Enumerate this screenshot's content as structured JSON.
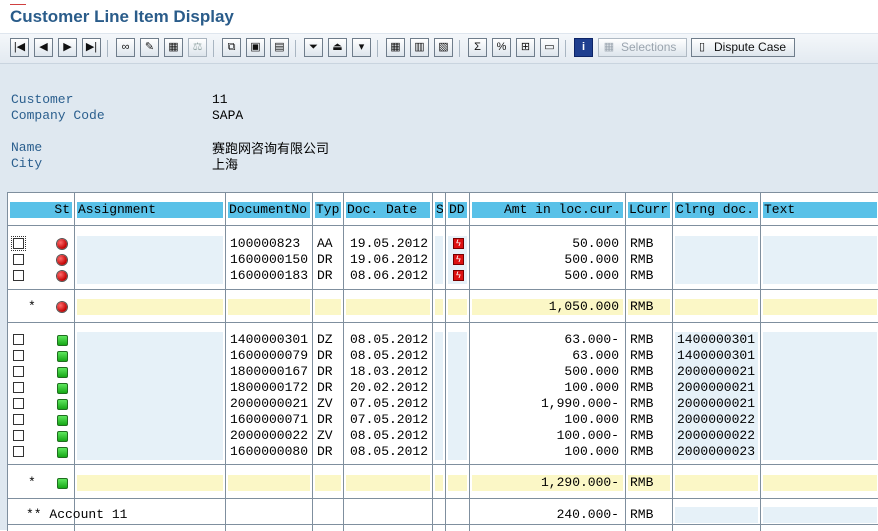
{
  "window": {
    "title": "Customer Line Item Display"
  },
  "toolbar": {
    "selections_label": "Selections",
    "dispute_case_label": "Dispute Case"
  },
  "header_fields": {
    "customer_label": "Customer",
    "customer_value": "11",
    "company_code_label": "Company Code",
    "company_code_value": "SAPA",
    "name_label": "Name",
    "name_value": "赛跑网咨询有限公司",
    "city_label": "City",
    "city_value": "上海"
  },
  "columns": {
    "st": "St",
    "assignment": "Assignment",
    "document_no": "DocumentNo",
    "type": "Typ",
    "doc_date": "Doc. Date",
    "s": "S",
    "dd": "DD",
    "amount": "Amt in loc.cur.",
    "lcurr": "LCurr",
    "clearing_doc": "Clrng doc.",
    "text": "Text"
  },
  "open_items": [
    {
      "document_no": "100000823",
      "type": "AA",
      "doc_date": "19.05.2012",
      "amount": "50.000",
      "lcurr": "RMB",
      "clearing_doc": "",
      "status": "red"
    },
    {
      "document_no": "1600000150",
      "type": "DR",
      "doc_date": "19.06.2012",
      "amount": "500.000",
      "lcurr": "RMB",
      "clearing_doc": "",
      "status": "red"
    },
    {
      "document_no": "1600000183",
      "type": "DR",
      "doc_date": "08.06.2012",
      "amount": "500.000",
      "lcurr": "RMB",
      "clearing_doc": "",
      "status": "red"
    }
  ],
  "open_subtotal": {
    "marker": "*",
    "amount": "1,050.000",
    "lcurr": "RMB"
  },
  "cleared_items": [
    {
      "document_no": "1400000301",
      "type": "DZ",
      "doc_date": "08.05.2012",
      "amount": "63.000-",
      "lcurr": "RMB",
      "clearing_doc": "1400000301"
    },
    {
      "document_no": "1600000079",
      "type": "DR",
      "doc_date": "08.05.2012",
      "amount": "63.000",
      "lcurr": "RMB",
      "clearing_doc": "1400000301"
    },
    {
      "document_no": "1800000167",
      "type": "DR",
      "doc_date": "18.03.2012",
      "amount": "500.000",
      "lcurr": "RMB",
      "clearing_doc": "2000000021"
    },
    {
      "document_no": "1800000172",
      "type": "DR",
      "doc_date": "20.02.2012",
      "amount": "100.000",
      "lcurr": "RMB",
      "clearing_doc": "2000000021"
    },
    {
      "document_no": "2000000021",
      "type": "ZV",
      "doc_date": "07.05.2012",
      "amount": "1,990.000-",
      "lcurr": "RMB",
      "clearing_doc": "2000000021"
    },
    {
      "document_no": "1600000071",
      "type": "DR",
      "doc_date": "07.05.2012",
      "amount": "100.000",
      "lcurr": "RMB",
      "clearing_doc": "2000000022"
    },
    {
      "document_no": "2000000022",
      "type": "ZV",
      "doc_date": "08.05.2012",
      "amount": "100.000-",
      "lcurr": "RMB",
      "clearing_doc": "2000000022"
    },
    {
      "document_no": "1600000080",
      "type": "DR",
      "doc_date": "08.05.2012",
      "amount": "100.000",
      "lcurr": "RMB",
      "clearing_doc": "2000000023"
    }
  ],
  "cleared_subtotal": {
    "marker": "*",
    "amount": "1,290.000-",
    "lcurr": "RMB"
  },
  "account_total": {
    "label": "** Account 11",
    "amount": "240.000-",
    "lcurr": "RMB"
  },
  "colors": {
    "header_blue": "#59c1e8",
    "row_blue": "#e6f1f8",
    "subtotal_yellow": "#fbf7c6",
    "title": "#2a5c8a"
  }
}
